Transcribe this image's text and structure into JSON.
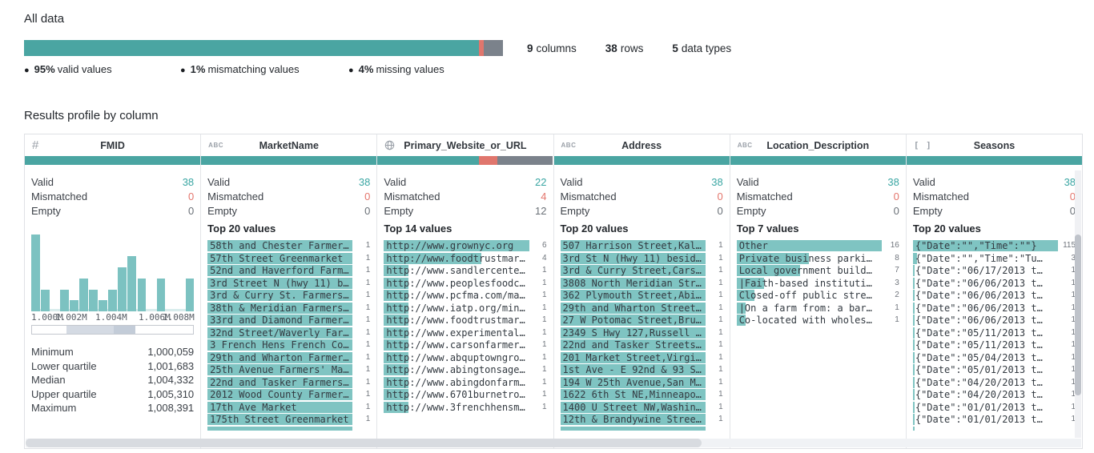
{
  "summary": {
    "title": "All data",
    "quality_bar": {
      "valid_pct": 95,
      "mismatch_pct": 1,
      "missing_pct": 4
    },
    "legend": [
      {
        "dot": "●",
        "value": "95%",
        "label": "valid values"
      },
      {
        "dot": "●",
        "value": "1%",
        "label": "mismatching values"
      },
      {
        "dot": "●",
        "value": "4%",
        "label": "missing values"
      }
    ],
    "dataset_stats": [
      {
        "value": "9",
        "label": "columns"
      },
      {
        "value": "38",
        "label": "rows"
      },
      {
        "value": "5",
        "label": "data types"
      }
    ]
  },
  "colors": {
    "valid": "#4aa5a2",
    "mismatch": "#e0766d",
    "missing": "#7b828b",
    "value_bar": "#7fc4c2"
  },
  "profile": {
    "title": "Results profile by column",
    "count_labels": {
      "valid": "Valid",
      "mismatched": "Mismatched",
      "empty": "Empty"
    },
    "columns": [
      {
        "name": "FMID",
        "type": "number",
        "icon": "#",
        "quality": {
          "valid": 100,
          "mismatch": 0,
          "missing": 0
        },
        "counts": {
          "valid": "38",
          "mismatched": "0",
          "empty": "0"
        },
        "histogram": {
          "bins": [
            7,
            2,
            0,
            2,
            1,
            3,
            2,
            1,
            2,
            4,
            5,
            3,
            0,
            3,
            0,
            0,
            3
          ],
          "axis_labels": [
            "1.000M",
            "1.002M",
            "1.004M",
            "1.006M",
            "1.008M"
          ]
        },
        "numeric_stats": [
          {
            "label": "Minimum",
            "value": "1,000,059"
          },
          {
            "label": "Lower quartile",
            "value": "1,001,683"
          },
          {
            "label": "Median",
            "value": "1,004,332"
          },
          {
            "label": "Upper quartile",
            "value": "1,005,310"
          },
          {
            "label": "Maximum",
            "value": "1,008,391"
          }
        ]
      },
      {
        "name": "MarketName",
        "type": "text",
        "icon": "ABC",
        "quality": {
          "valid": 100,
          "mismatch": 0,
          "missing": 0
        },
        "counts": {
          "valid": "38",
          "mismatched": "0",
          "empty": "0"
        },
        "top_label": "Top 20 values",
        "values": [
          {
            "text": "58th and Chester Farmer…",
            "count": "1",
            "frac": 1
          },
          {
            "text": "57th Street Greenmarket",
            "count": "1",
            "frac": 1
          },
          {
            "text": "52nd and Haverford Farm…",
            "count": "1",
            "frac": 1
          },
          {
            "text": "3rd Street N (hwy 11) b…",
            "count": "1",
            "frac": 1
          },
          {
            "text": "3rd & Curry St. Farmers…",
            "count": "1",
            "frac": 1
          },
          {
            "text": "38th & Meridian Farmers…",
            "count": "1",
            "frac": 1
          },
          {
            "text": "33rd and Diamond Farmer…",
            "count": "1",
            "frac": 1
          },
          {
            "text": "32nd Street/Waverly Far…",
            "count": "1",
            "frac": 1
          },
          {
            "text": "3 French Hens French Co…",
            "count": "1",
            "frac": 1
          },
          {
            "text": "29th and Wharton Farmer…",
            "count": "1",
            "frac": 1
          },
          {
            "text": "25th Avenue Farmers' Ma…",
            "count": "1",
            "frac": 1
          },
          {
            "text": "22nd and Tasker Farmers…",
            "count": "1",
            "frac": 1
          },
          {
            "text": "2012 Wood County Farmer…",
            "count": "1",
            "frac": 1
          },
          {
            "text": "17th Ave Market",
            "count": "1",
            "frac": 1
          },
          {
            "text": "175th Street Greenmarket",
            "count": "1",
            "frac": 1
          },
          {
            "text": "",
            "count": "",
            "frac": 1,
            "partial": true
          }
        ]
      },
      {
        "name": "Primary_Website_or_URL",
        "type": "url",
        "icon": "globe",
        "quality": {
          "valid": 57.9,
          "mismatch": 10.5,
          "missing": 31.6
        },
        "counts": {
          "valid": "22",
          "mismatched": "4",
          "empty": "12"
        },
        "top_label": "Top 14 values",
        "values": [
          {
            "text": "http://www.grownyc.org",
            "count": "6",
            "frac": 1
          },
          {
            "text": "http://www.foodtrustmar…",
            "count": "4",
            "frac": 0.67
          },
          {
            "text": "http://www.sandlercente…",
            "count": "1",
            "frac": 0.17
          },
          {
            "text": "http://www.peoplesfoodc…",
            "count": "1",
            "frac": 0.17
          },
          {
            "text": "http://www.pcfma.com/ma…",
            "count": "1",
            "frac": 0.17
          },
          {
            "text": "http://www.iatp.org/min…",
            "count": "1",
            "frac": 0.17
          },
          {
            "text": "http://www.foodtrustmar…",
            "count": "1",
            "frac": 0.17
          },
          {
            "text": "http://www.experimental…",
            "count": "1",
            "frac": 0.17
          },
          {
            "text": "http://www.carsonfarmer…",
            "count": "1",
            "frac": 0.17
          },
          {
            "text": "http://www.abquptowngro…",
            "count": "1",
            "frac": 0.17
          },
          {
            "text": "http://www.abingtonsage…",
            "count": "1",
            "frac": 0.17
          },
          {
            "text": "http://www.abingdonfarm…",
            "count": "1",
            "frac": 0.17
          },
          {
            "text": "http://www.6701burnetro…",
            "count": "1",
            "frac": 0.17
          },
          {
            "text": "http://www.3frenchhensm…",
            "count": "1",
            "frac": 0.17
          }
        ]
      },
      {
        "name": "Address",
        "type": "text",
        "icon": "ABC",
        "quality": {
          "valid": 100,
          "mismatch": 0,
          "missing": 0
        },
        "counts": {
          "valid": "38",
          "mismatched": "0",
          "empty": "0"
        },
        "top_label": "Top 20 values",
        "values": [
          {
            "text": "507 Harrison Street,Kal…",
            "count": "1",
            "frac": 1
          },
          {
            "text": "3rd St N (Hwy 11) besid…",
            "count": "1",
            "frac": 1
          },
          {
            "text": "3rd & Curry Street,Cars…",
            "count": "1",
            "frac": 1
          },
          {
            "text": "3808 North Meridian Str…",
            "count": "1",
            "frac": 1
          },
          {
            "text": "362 Plymouth Street,Abi…",
            "count": "1",
            "frac": 1
          },
          {
            "text": "29th and Wharton Street…",
            "count": "1",
            "frac": 1
          },
          {
            "text": "27 W Potomac Street,Bru…",
            "count": "1",
            "frac": 1
          },
          {
            "text": "2349 S Hwy 127,Russell …",
            "count": "1",
            "frac": 1
          },
          {
            "text": "22nd and Tasker Streets…",
            "count": "1",
            "frac": 1
          },
          {
            "text": "201 Market Street,Virgi…",
            "count": "1",
            "frac": 1
          },
          {
            "text": "1st Ave - E 92nd & 93 S…",
            "count": "1",
            "frac": 1
          },
          {
            "text": "194 W 25th Avenue,San M…",
            "count": "1",
            "frac": 1
          },
          {
            "text": "1622 6th St NE,Minneapo…",
            "count": "1",
            "frac": 1
          },
          {
            "text": "1400 U Street NW,Washin…",
            "count": "1",
            "frac": 1
          },
          {
            "text": "12th & Brandywine Stree…",
            "count": "1",
            "frac": 1
          },
          {
            "text": "",
            "count": "",
            "frac": 1,
            "partial": true
          }
        ]
      },
      {
        "name": "Location_Description",
        "type": "text",
        "icon": "ABC",
        "quality": {
          "valid": 100,
          "mismatch": 0,
          "missing": 0
        },
        "counts": {
          "valid": "38",
          "mismatched": "0",
          "empty": "0"
        },
        "top_label": "Top 7 values",
        "values": [
          {
            "text": "Other",
            "count": "16",
            "frac": 1
          },
          {
            "text": "Private business parki…",
            "count": "8",
            "frac": 0.5
          },
          {
            "text": "Local government build…",
            "count": "7",
            "frac": 0.44
          },
          {
            "text": "|Faith-based instituti…",
            "count": "3",
            "frac": 0.19
          },
          {
            "text": "Closed-off public stre…",
            "count": "2",
            "frac": 0.125
          },
          {
            "text": "|On a farm from: a bar…",
            "count": "1",
            "frac": 0.0625
          },
          {
            "text": "Co-located with wholes…",
            "count": "1",
            "frac": 0.0625
          }
        ]
      },
      {
        "name": "Seasons",
        "type": "array",
        "icon": "[ ]",
        "quality": {
          "valid": 100,
          "mismatch": 0,
          "missing": 0
        },
        "counts": {
          "valid": "38",
          "mismatched": "0",
          "empty": "0"
        },
        "top_label": "Top 20 values",
        "values": [
          {
            "text": "{\"Date\":\"\",\"Time\":\"\"}",
            "count": "115",
            "frac": 1
          },
          {
            "text": "{\"Date\":\"\",\"Time\":\"Tu…",
            "count": "3",
            "frac": 0.026
          },
          {
            "text": "{\"Date\":\"06/17/2013 t…",
            "count": "1",
            "frac": 0.009
          },
          {
            "text": "{\"Date\":\"06/06/2013 t…",
            "count": "1",
            "frac": 0.009
          },
          {
            "text": "{\"Date\":\"06/06/2013 t…",
            "count": "1",
            "frac": 0.009
          },
          {
            "text": "{\"Date\":\"06/06/2013 t…",
            "count": "1",
            "frac": 0.009
          },
          {
            "text": "{\"Date\":\"06/06/2013 t…",
            "count": "1",
            "frac": 0.009
          },
          {
            "text": "{\"Date\":\"05/11/2013 t…",
            "count": "1",
            "frac": 0.009
          },
          {
            "text": "{\"Date\":\"05/11/2013 t…",
            "count": "1",
            "frac": 0.009
          },
          {
            "text": "{\"Date\":\"05/04/2013 t…",
            "count": "1",
            "frac": 0.009
          },
          {
            "text": "{\"Date\":\"05/01/2013 t…",
            "count": "1",
            "frac": 0.009
          },
          {
            "text": "{\"Date\":\"04/20/2013 t…",
            "count": "1",
            "frac": 0.009
          },
          {
            "text": "{\"Date\":\"04/20/2013 t…",
            "count": "1",
            "frac": 0.009
          },
          {
            "text": "{\"Date\":\"01/01/2013 t…",
            "count": "1",
            "frac": 0.009
          },
          {
            "text": "{\"Date\":\"01/01/2013 t…",
            "count": "1",
            "frac": 0.009
          },
          {
            "text": "",
            "count": "",
            "frac": 0.009,
            "partial": true
          }
        ]
      }
    ]
  }
}
